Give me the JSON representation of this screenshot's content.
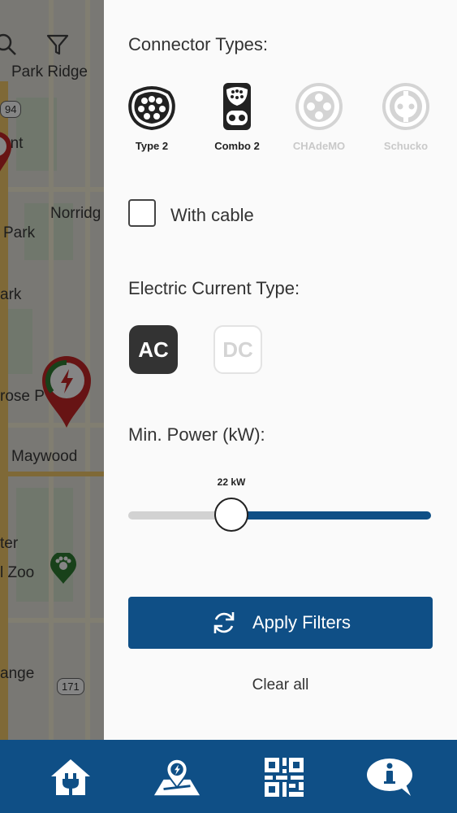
{
  "map": {
    "labels": [
      "Park Ridge",
      "ont",
      "Norridg",
      "Park",
      "ark",
      "rose P",
      "Maywood",
      "ter",
      "l Zoo",
      "ange"
    ],
    "shields": [
      "94",
      "171"
    ]
  },
  "filters": {
    "connector_title": "Connector Types:",
    "connectors": [
      {
        "label": "Type 2",
        "selected": true
      },
      {
        "label": "Combo 2",
        "selected": true
      },
      {
        "label": "CHAdeMO",
        "selected": false
      },
      {
        "label": "Schucko",
        "selected": false
      }
    ],
    "with_cable_label": "With cable",
    "with_cable_checked": false,
    "current_title": "Electric Current Type:",
    "current_ac": "AC",
    "current_dc": "DC",
    "current_selected": "AC",
    "power_title": "Min. Power (kW):",
    "power_value_label": "22 kW",
    "power_value": 22,
    "apply_label": "Apply Filters",
    "clear_label": "Clear all"
  },
  "nav": {
    "items": [
      {
        "icon": "home-plug-icon"
      },
      {
        "icon": "map-charging-icon"
      },
      {
        "icon": "qr-code-icon"
      },
      {
        "icon": "info-chat-icon"
      }
    ]
  },
  "colors": {
    "primary": "#0f4f86",
    "active_dark": "#333333",
    "disabled": "#c9c9c9",
    "marker_red": "#c62828",
    "marker_green": "#2e7d32"
  }
}
